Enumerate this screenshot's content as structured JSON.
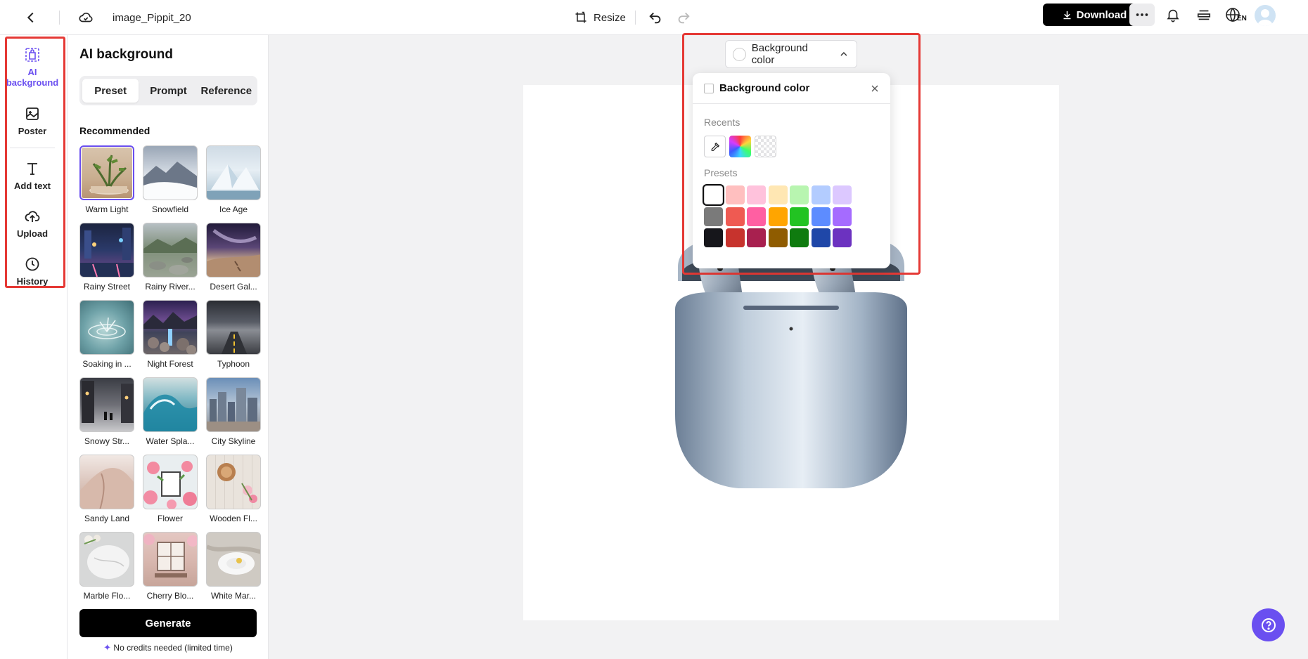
{
  "header": {
    "doc_title": "image_Pippit_20",
    "resize_label": "Resize",
    "download_label": "Download",
    "lang_badge": "EN"
  },
  "rail": {
    "items": [
      {
        "label": "AI background",
        "icon": "ai-background-icon",
        "active": true
      },
      {
        "label": "Poster",
        "icon": "poster-icon"
      },
      {
        "label": "Add text",
        "icon": "text-icon"
      },
      {
        "label": "Upload",
        "icon": "upload-cloud-icon"
      },
      {
        "label": "History",
        "icon": "clock-icon"
      }
    ]
  },
  "panel": {
    "title": "AI background",
    "tabs": [
      "Preset",
      "Prompt",
      "Reference"
    ],
    "active_tab": "Preset",
    "section": "Recommended",
    "tiles": [
      {
        "label": "Warm Light",
        "selected": true
      },
      {
        "label": "Snowfield"
      },
      {
        "label": "Ice Age"
      },
      {
        "label": "Rainy Street"
      },
      {
        "label": "Rainy River..."
      },
      {
        "label": "Desert Gal..."
      },
      {
        "label": "Soaking in ..."
      },
      {
        "label": "Night Forest"
      },
      {
        "label": "Typhoon"
      },
      {
        "label": "Snowy Str..."
      },
      {
        "label": "Water Spla..."
      },
      {
        "label": "City Skyline"
      },
      {
        "label": "Sandy Land"
      },
      {
        "label": "Flower"
      },
      {
        "label": "Wooden Fl..."
      },
      {
        "label": "Marble Flo..."
      },
      {
        "label": "Cherry Blo..."
      },
      {
        "label": "White Mar..."
      }
    ],
    "generate_label": "Generate",
    "credits_note": "No credits needed (limited time)"
  },
  "color_picker": {
    "button_label": "Background color",
    "title": "Background color",
    "recents_label": "Recents",
    "presets_label": "Presets",
    "presets": [
      [
        "#ffffff",
        "#ffbfbf",
        "#ffc2dc",
        "#ffe7b3",
        "#b8f5b0",
        "#b3ccff",
        "#dcc8ff"
      ],
      [
        "#7a7a7a",
        "#ef5a52",
        "#ff5fa2",
        "#ffa500",
        "#22c322",
        "#5d8cff",
        "#a56bff"
      ],
      [
        "#16161b",
        "#c7332d",
        "#a8204f",
        "#8f5c00",
        "#0f7b0f",
        "#1f47a8",
        "#6c32c0"
      ]
    ]
  },
  "colors": {
    "accent": "#6a4ff0",
    "highlight": "#e53935"
  }
}
